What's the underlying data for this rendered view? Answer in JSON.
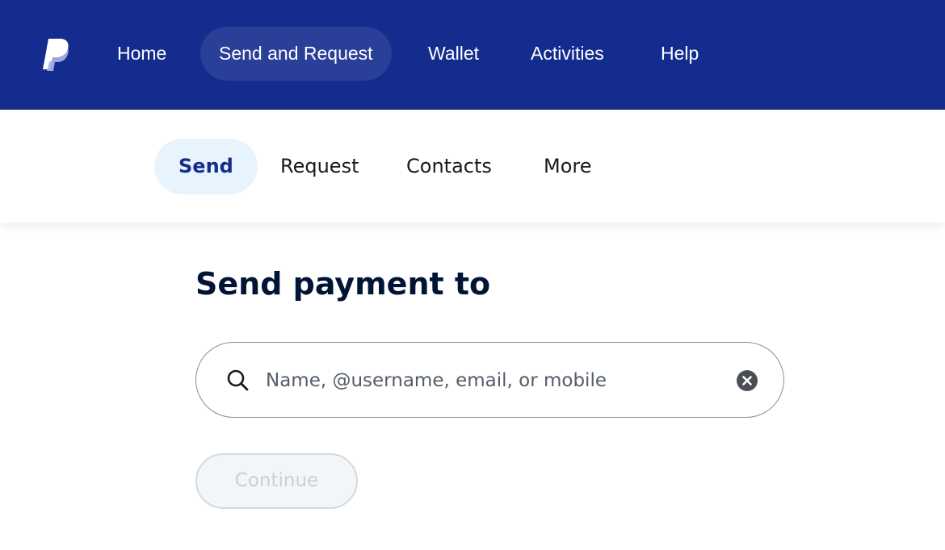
{
  "topnav": {
    "items": [
      {
        "label": "Home"
      },
      {
        "label": "Send and Request",
        "active": true
      },
      {
        "label": "Wallet"
      },
      {
        "label": "Activities"
      },
      {
        "label": "Help"
      }
    ]
  },
  "subnav": {
    "items": [
      {
        "label": "Send",
        "active": true
      },
      {
        "label": "Request"
      },
      {
        "label": "Contacts"
      },
      {
        "label": "More"
      }
    ]
  },
  "main": {
    "title": "Send payment to",
    "search": {
      "placeholder": "Name, @username, email, or mobile",
      "value": ""
    },
    "continue_label": "Continue",
    "continue_disabled": true
  },
  "colors": {
    "brand_navy": "#142c8e",
    "active_pill_dark": "#2a3f98",
    "active_pill_light": "#e8f4fd"
  },
  "icons": {
    "logo": "paypal-logo",
    "search": "search-icon",
    "clear": "clear-icon"
  }
}
